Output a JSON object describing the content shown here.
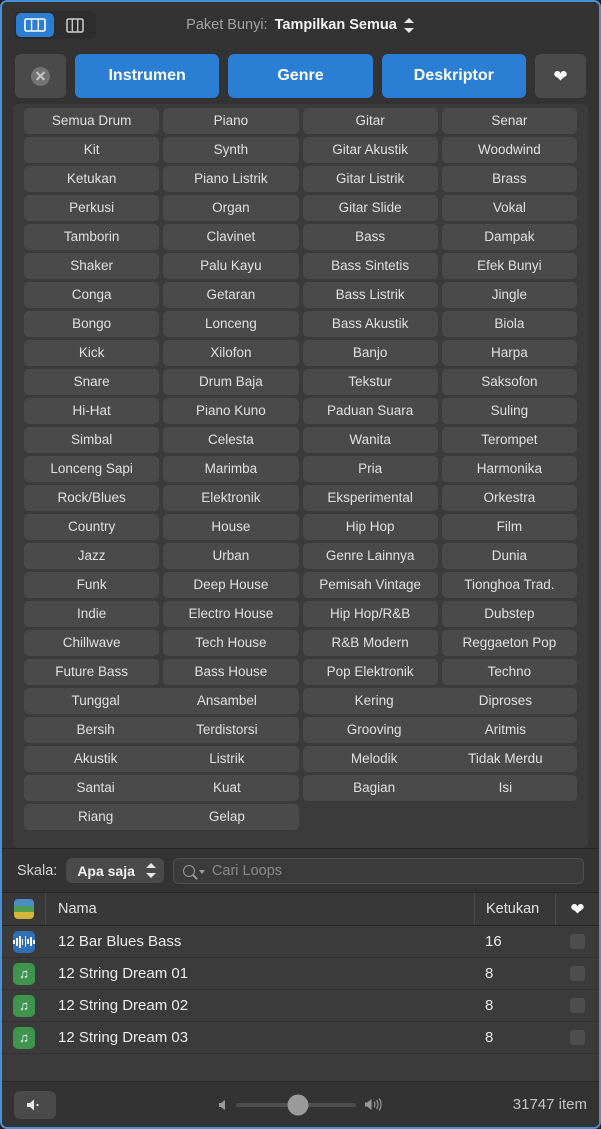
{
  "topbar": {
    "view_grid_icon": "grid-wide-icon",
    "view_column_icon": "grid-column-icon",
    "package_label": "Paket Bunyi:",
    "package_value": "Tampilkan Semua",
    "stepper_icon": "updown-stepper-icon"
  },
  "categories": {
    "clear_icon": "clear-circle-x-icon",
    "tabs": [
      {
        "label": "Instrumen"
      },
      {
        "label": "Genre"
      },
      {
        "label": "Deskriptor"
      }
    ],
    "favorite_icon": "heart-icon"
  },
  "keyword_grid": {
    "rows": [
      {
        "wide": false,
        "cells": [
          "Semua Drum",
          "Piano",
          "Gitar",
          "Senar"
        ]
      },
      {
        "wide": false,
        "cells": [
          "Kit",
          "Synth",
          "Gitar Akustik",
          "Woodwind"
        ]
      },
      {
        "wide": false,
        "cells": [
          "Ketukan",
          "Piano Listrik",
          "Gitar Listrik",
          "Brass"
        ]
      },
      {
        "wide": false,
        "cells": [
          "Perkusi",
          "Organ",
          "Gitar Slide",
          "Vokal"
        ]
      },
      {
        "wide": false,
        "cells": [
          "Tamborin",
          "Clavinet",
          "Bass",
          "Dampak"
        ]
      },
      {
        "wide": false,
        "cells": [
          "Shaker",
          "Palu Kayu",
          "Bass Sintetis",
          "Efek Bunyi"
        ]
      },
      {
        "wide": false,
        "cells": [
          "Conga",
          "Getaran",
          "Bass Listrik",
          "Jingle"
        ]
      },
      {
        "wide": false,
        "cells": [
          "Bongo",
          "Lonceng",
          "Bass Akustik",
          "Biola"
        ]
      },
      {
        "wide": false,
        "cells": [
          "Kick",
          "Xilofon",
          "Banjo",
          "Harpa"
        ]
      },
      {
        "wide": false,
        "cells": [
          "Snare",
          "Drum Baja",
          "Tekstur",
          "Saksofon"
        ]
      },
      {
        "wide": false,
        "cells": [
          "Hi-Hat",
          "Piano Kuno",
          "Paduan Suara",
          "Suling"
        ]
      },
      {
        "wide": false,
        "cells": [
          "Simbal",
          "Celesta",
          "Wanita",
          "Terompet"
        ]
      },
      {
        "wide": false,
        "cells": [
          "Lonceng Sapi",
          "Marimba",
          "Pria",
          "Harmonika"
        ]
      },
      {
        "wide": false,
        "cells": [
          "Rock/Blues",
          "Elektronik",
          "Eksperimental",
          "Orkestra"
        ]
      },
      {
        "wide": false,
        "cells": [
          "Country",
          "House",
          "Hip Hop",
          "Film"
        ]
      },
      {
        "wide": false,
        "cells": [
          "Jazz",
          "Urban",
          "Genre Lainnya",
          "Dunia"
        ]
      },
      {
        "wide": false,
        "cells": [
          "Funk",
          "Deep House",
          "Pemisah Vintage",
          "Tionghoa Trad."
        ]
      },
      {
        "wide": false,
        "cells": [
          "Indie",
          "Electro House",
          "Hip Hop/R&B",
          "Dubstep"
        ]
      },
      {
        "wide": false,
        "cells": [
          "Chillwave",
          "Tech House",
          "R&B Modern",
          "Reggaeton Pop"
        ]
      },
      {
        "wide": false,
        "cells": [
          "Future Bass",
          "Bass House",
          "Pop Elektronik",
          "Techno"
        ]
      },
      {
        "wide": true,
        "cells": [
          "Tunggal",
          "Ansambel",
          "Kering",
          "Diproses"
        ]
      },
      {
        "wide": true,
        "cells": [
          "Bersih",
          "Terdistorsi",
          "Grooving",
          "Aritmis"
        ]
      },
      {
        "wide": true,
        "cells": [
          "Akustik",
          "Listrik",
          "Melodik",
          "Tidak Merdu"
        ]
      },
      {
        "wide": true,
        "cells": [
          "Santai",
          "Kuat",
          "Bagian",
          "Isi"
        ]
      },
      {
        "wide": true,
        "cells": [
          "Riang",
          "Gelap",
          "",
          ""
        ]
      }
    ]
  },
  "filterbar": {
    "scale_label": "Skala:",
    "scale_value": "Apa saja",
    "search_placeholder": "Cari Loops",
    "search_value": "",
    "search_icon": "magnifier-icon"
  },
  "list": {
    "header": {
      "type_icon": "color-stack-icon",
      "name": "Nama",
      "beats": "Ketukan",
      "favorite_icon": "heart-icon"
    },
    "rows": [
      {
        "icon": "waveform-icon",
        "icon_color": "blue",
        "name": "12 Bar Blues Bass",
        "beats": "16",
        "favorite": false
      },
      {
        "icon": "music-note-icon",
        "icon_color": "green",
        "name": "12 String Dream 01",
        "beats": "8",
        "favorite": false
      },
      {
        "icon": "music-note-icon",
        "icon_color": "green",
        "name": "12 String Dream 02",
        "beats": "8",
        "favorite": false
      },
      {
        "icon": "music-note-icon",
        "icon_color": "green",
        "name": "12 String Dream 03",
        "beats": "8",
        "favorite": false
      }
    ]
  },
  "bottombar": {
    "mute_icon": "speaker-mute-icon",
    "volume_low_icon": "speaker-low-icon",
    "volume_high_icon": "speaker-high-icon",
    "volume_value": 52,
    "item_count": "31747 item"
  },
  "colors": {
    "accent": "#2a7fd4",
    "window_bg": "#333333",
    "grid_bg": "#3b3b3b",
    "cell_bg": "#4a4a4a",
    "border": "#4a90d9",
    "icon_blue": "#2f6fb5",
    "icon_green": "#3f9550"
  }
}
